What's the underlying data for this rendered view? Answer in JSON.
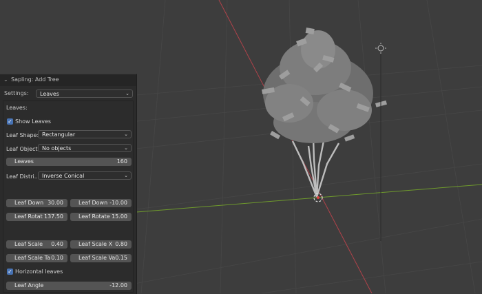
{
  "panel": {
    "title": "Sapling: Add Tree",
    "settings_label": "Settings:",
    "settings_value": "Leaves",
    "section_title": "Leaves:",
    "show_leaves": {
      "label": "Show Leaves",
      "checked": true
    },
    "leaf_shape": {
      "label": "Leaf Shape:",
      "value": "Rectangular"
    },
    "leaf_object": {
      "label": "Leaf Object:",
      "value": "No objects"
    },
    "leaves": {
      "label": "Leaves",
      "value": "160"
    },
    "leaf_distribution": {
      "label": "Leaf Distri...",
      "value": "Inverse Conical"
    },
    "leaf_down": {
      "label": "Leaf Down",
      "value": "30.00"
    },
    "leaf_down_v": {
      "label": "Leaf Down",
      "value": "-10.00"
    },
    "leaf_rotate": {
      "label": "Leaf Rotat",
      "value": "137.50"
    },
    "leaf_rotate_v": {
      "label": "Leaf Rotate",
      "value": "15.00"
    },
    "leaf_scale": {
      "label": "Leaf Scale",
      "value": "0.40"
    },
    "leaf_scale_x": {
      "label": "Leaf Scale X",
      "value": "0.80"
    },
    "leaf_scale_taper": {
      "label": "Leaf Scale Ta",
      "value": "0.10"
    },
    "leaf_scale_var": {
      "label": "Leaf Scale Va",
      "value": "0.15"
    },
    "horizontal_leaves": {
      "label": "Horizontal leaves",
      "checked": true
    },
    "leaf_angle": {
      "label": "Leaf Angle",
      "value": "-12.00"
    }
  },
  "icons": [
    "chevron-down-icon",
    "checkbox-icon",
    "light-gizmo-icon",
    "origin-icon"
  ],
  "colors": {
    "background": "#3d3d3d",
    "panel": "#2b2b2b",
    "field": "#545454",
    "accent": "#4772b3",
    "x_axis": "#b0424a",
    "y_axis": "#6f9b2c"
  }
}
